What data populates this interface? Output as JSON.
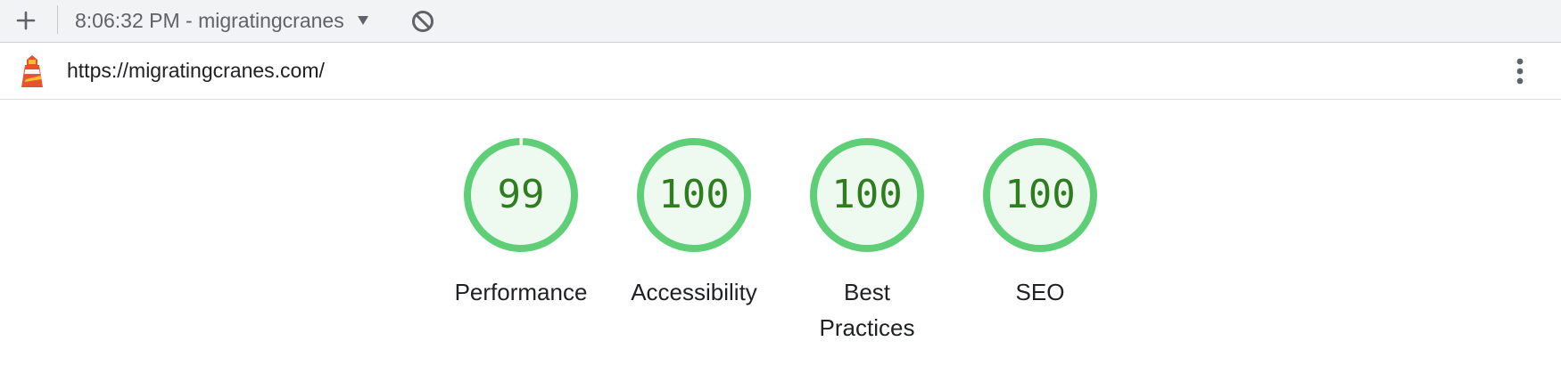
{
  "toolbar": {
    "report_label": "8:06:32 PM - migratingcranes"
  },
  "urlbar": {
    "url": "https://migratingcranes.com/"
  },
  "colors": {
    "pass": "#5fcf77",
    "pass_fill": "#eefaf0",
    "pass_text": "#2e7d1e"
  },
  "categories": [
    {
      "label": "Performance",
      "score": "99"
    },
    {
      "label": "Accessibility",
      "score": "100"
    },
    {
      "label": "Best Practices",
      "score": "100"
    },
    {
      "label": "SEO",
      "score": "100"
    }
  ]
}
